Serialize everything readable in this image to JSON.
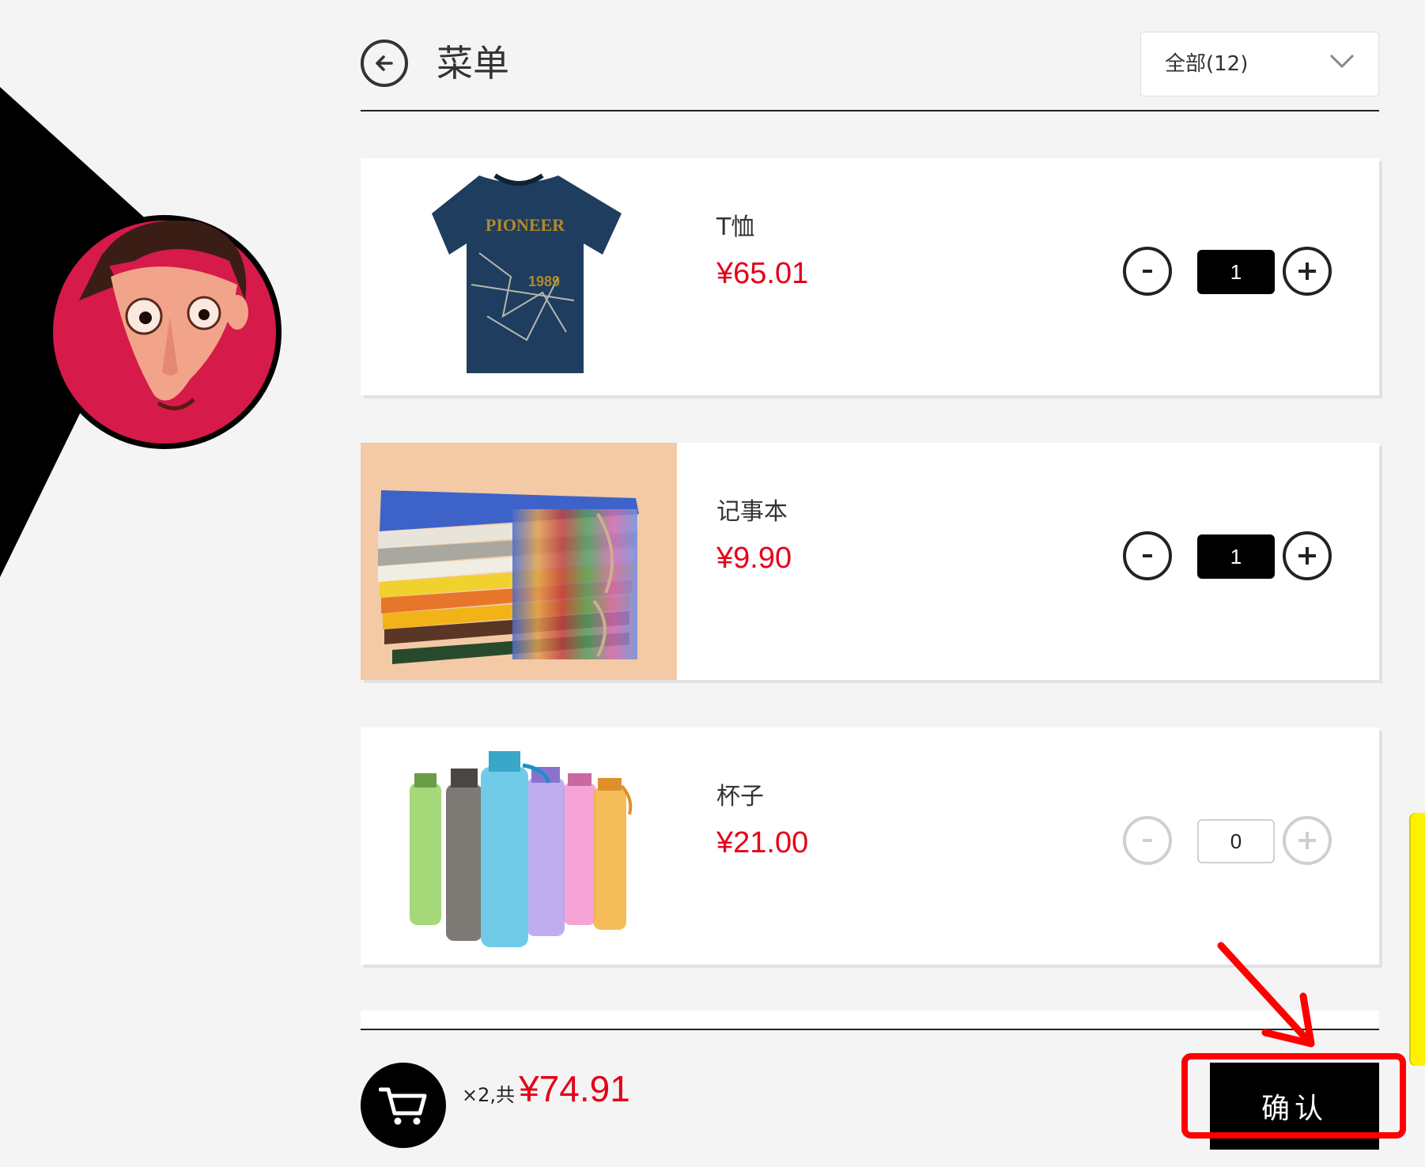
{
  "header": {
    "title": "菜单",
    "filter_label": "全部(12)"
  },
  "products": [
    {
      "name": "T恤",
      "price": "¥65.01",
      "quantity": "1",
      "enabled": true,
      "image": "tshirt-image",
      "image_text": "PIONEER",
      "image_subtext": "1989"
    },
    {
      "name": "记事本",
      "price": "¥9.90",
      "quantity": "1",
      "enabled": true,
      "image": "notebook-stack-image"
    },
    {
      "name": "杯子",
      "price": "¥21.00",
      "quantity": "0",
      "enabled": false,
      "image": "water-bottles-image"
    }
  ],
  "footer": {
    "count_text": "×2,共",
    "total_text": "¥74.91",
    "confirm_label": "确认"
  },
  "colors": {
    "price": "#e5001a",
    "accent": "#000000",
    "annotation": "#ff0000",
    "side_tab": "#fff200",
    "avatar_bg": "#d61a4a"
  }
}
